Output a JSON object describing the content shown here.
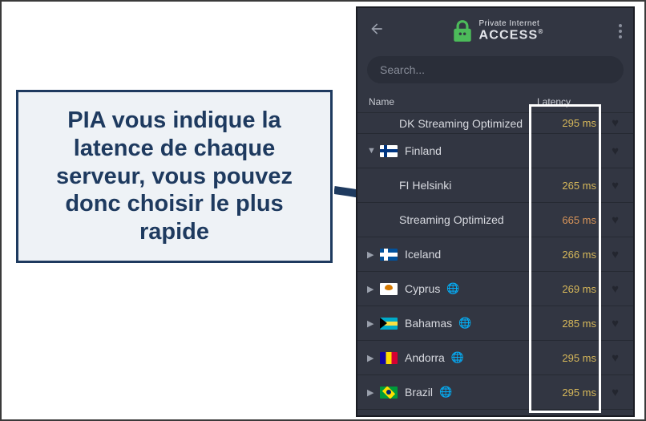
{
  "callout": {
    "text": "PIA vous indique la latence de chaque serveur, vous pouvez donc choisir le plus rapide"
  },
  "app": {
    "brand": {
      "line1": "Private Internet",
      "line2": "ACCESS"
    },
    "search": {
      "placeholder": "Search..."
    },
    "columns": {
      "name": "Name",
      "latency": "Latency"
    },
    "servers": [
      {
        "name": "DK Streaming Optimized",
        "latency": "295 ms",
        "indent": "partial",
        "flag": "",
        "geo": false,
        "high": false
      },
      {
        "name": "Finland",
        "latency": "",
        "indent": "parent",
        "flag": "fi",
        "geo": false,
        "high": false,
        "expanded": true
      },
      {
        "name": "FI Helsinki",
        "latency": "265 ms",
        "indent": "child",
        "flag": "",
        "geo": false,
        "high": false
      },
      {
        "name": "Streaming Optimized",
        "latency": "665 ms",
        "indent": "partialvis",
        "flag": "",
        "geo": false,
        "high": true
      },
      {
        "name": "Iceland",
        "latency": "266 ms",
        "indent": "top",
        "flag": "is",
        "geo": false,
        "high": false
      },
      {
        "name": "Cyprus",
        "latency": "269 ms",
        "indent": "top",
        "flag": "cy",
        "geo": true,
        "high": false
      },
      {
        "name": "Bahamas",
        "latency": "285 ms",
        "indent": "top",
        "flag": "bs",
        "geo": true,
        "high": false
      },
      {
        "name": "Andorra",
        "latency": "295 ms",
        "indent": "top",
        "flag": "ad",
        "geo": true,
        "high": false
      },
      {
        "name": "Brazil",
        "latency": "295 ms",
        "indent": "top",
        "flag": "br",
        "geo": true,
        "high": false
      }
    ]
  }
}
